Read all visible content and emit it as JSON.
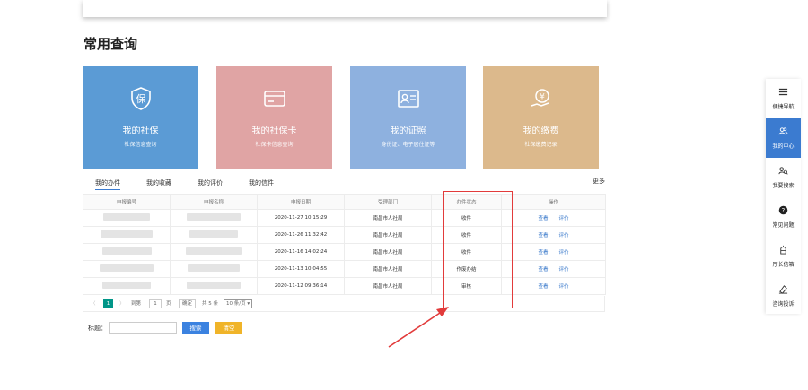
{
  "section_title": "常用查询",
  "cards": [
    {
      "title": "我的社保",
      "subtitle": "社保信息查询",
      "color": "#5b9bd5",
      "icon": "shield-bao-icon"
    },
    {
      "title": "我的社保卡",
      "subtitle": "社保卡信息查询",
      "color": "#e0a4a4",
      "icon": "card-icon"
    },
    {
      "title": "我的证照",
      "subtitle": "身份证、电子居住证等",
      "color": "#8eb1df",
      "icon": "id-card-icon"
    },
    {
      "title": "我的缴费",
      "subtitle": "社保缴费记录",
      "color": "#dcb98c",
      "icon": "payment-icon"
    }
  ],
  "tabs": [
    "我的办件",
    "我的收藏",
    "我的评价",
    "我的信件"
  ],
  "more": "更多",
  "table": {
    "headers": [
      "申报编号",
      "申报名称",
      "申报日期",
      "受理部门",
      "办件状态",
      "操作"
    ],
    "rows": [
      {
        "date": "2020-11-27 10:15:29",
        "dept": "南昌市人社局",
        "status": "收件",
        "view": "查看",
        "rate": "评价"
      },
      {
        "date": "2020-11-26 11:32:42",
        "dept": "南昌市人社局",
        "status": "收件",
        "view": "查看",
        "rate": "评价"
      },
      {
        "date": "2020-11-16 14:02:24",
        "dept": "南昌市人社局",
        "status": "收件",
        "view": "查看",
        "rate": "评价"
      },
      {
        "date": "2020-11-13 10:04:55",
        "dept": "南昌市人社局",
        "status": "作废办结",
        "view": "查看",
        "rate": "评价"
      },
      {
        "date": "2020-11-12 09:36:14",
        "dept": "南昌市人社局",
        "status": "审核",
        "view": "查看",
        "rate": "评价"
      }
    ]
  },
  "pager": {
    "prev": "〈",
    "current": "1",
    "next": "〉",
    "goto_label": "到第",
    "goto_value": "1",
    "page_unit": "页",
    "confirm": "确定",
    "total": "共 5 条",
    "per_page": "10 条/页"
  },
  "search": {
    "label": "标题：",
    "search_btn": "搜索",
    "clear_btn": "清空"
  },
  "sidebar": [
    {
      "label": "便捷导航",
      "icon": "menu-icon"
    },
    {
      "label": "我的中心",
      "icon": "users-icon"
    },
    {
      "label": "我要搜索",
      "icon": "search-people-icon"
    },
    {
      "label": "常见问题",
      "icon": "question-icon"
    },
    {
      "label": "厅长信箱",
      "icon": "mailbox-icon"
    },
    {
      "label": "咨询投诉",
      "icon": "complaint-icon"
    }
  ]
}
